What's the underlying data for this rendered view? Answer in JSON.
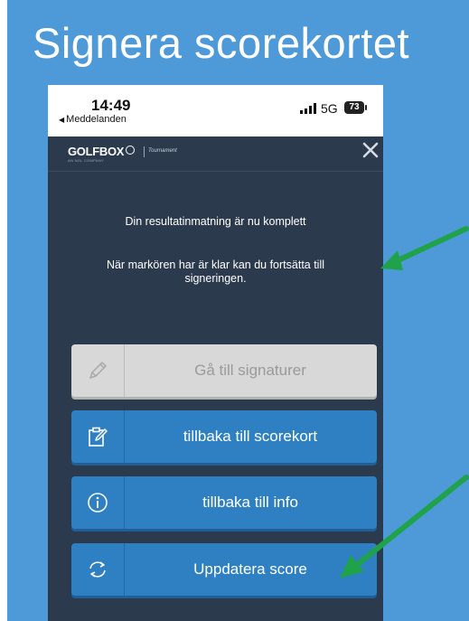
{
  "slide": {
    "title": "Signera scorekortet",
    "background_color": "#4e9ad9",
    "arrow_color": "#1fa24a"
  },
  "status_bar": {
    "time": "14:49",
    "back_label": "Meddelanden",
    "network": "5G",
    "battery": "73"
  },
  "header": {
    "logo": "GOLFBOX",
    "logo_sub": "AN NGL COMPANY",
    "context": "Tournament",
    "close_icon": "close-icon"
  },
  "messages": {
    "complete": "Din resultatinmatning är nu komplett",
    "continue": "När markören har är klar kan du fortsätta till signeringen."
  },
  "buttons": [
    {
      "label": "Gå till signaturer",
      "icon": "pen-icon",
      "disabled": true
    },
    {
      "label": "tillbaka till scorekort",
      "icon": "clipboard-edit-icon",
      "disabled": false
    },
    {
      "label": "tillbaka till info",
      "icon": "info-icon",
      "disabled": false
    },
    {
      "label": "Uppdatera score",
      "icon": "refresh-icon",
      "disabled": false
    }
  ],
  "colors": {
    "app_background": "#2b3a4d",
    "button_primary": "#2e80c2",
    "button_disabled": "#d8d8d8"
  }
}
